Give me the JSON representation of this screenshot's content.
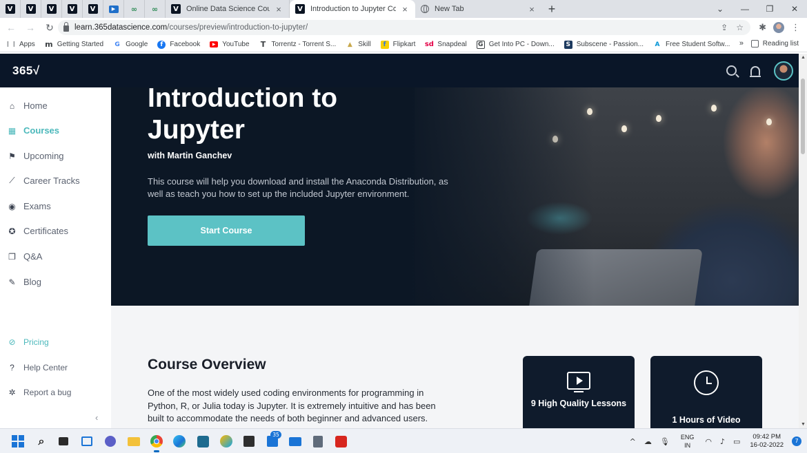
{
  "browser": {
    "tabs": [
      {
        "title": "Online Data Science Courses and",
        "active": false
      },
      {
        "title": "Introduction to Jupyter Course |",
        "active": true
      },
      {
        "title": "New Tab",
        "active": false
      }
    ],
    "close_glyph": "×",
    "new_tab_glyph": "+",
    "window_controls": [
      "⌄",
      "—",
      "❐",
      "✕"
    ],
    "url_host": "learn.365datascience.com",
    "url_path": "/courses/preview/introduction-to-jupyter/",
    "bookmarks": [
      {
        "label": "Apps",
        "icon": "apps-grid-icon",
        "color": "#5f6368"
      },
      {
        "label": "Getting Started",
        "icon": "m-icon",
        "color": "#3c4043"
      },
      {
        "label": "Google",
        "icon": "google-icon",
        "color": "#4285f4"
      },
      {
        "label": "Facebook",
        "icon": "facebook-icon",
        "color": "#1877f2"
      },
      {
        "label": "YouTube",
        "icon": "youtube-icon",
        "color": "#ff0000"
      },
      {
        "label": "Torrentz - Torrent S...",
        "icon": "t-icon",
        "color": "#3c4043"
      },
      {
        "label": "Skill",
        "icon": "skill-icon",
        "color": "#c8a84b"
      },
      {
        "label": "Flipkart",
        "icon": "flipkart-icon",
        "color": "#f8d000"
      },
      {
        "label": "Snapdeal",
        "icon": "snapdeal-icon",
        "color": "#e40046"
      },
      {
        "label": "Get Into PC - Down...",
        "icon": "g-icon",
        "color": "#3c4043"
      },
      {
        "label": "Subscene - Passion...",
        "icon": "s-icon",
        "color": "#3c4043"
      },
      {
        "label": "Free Student Softw...",
        "icon": "autodesk-icon",
        "color": "#0696d7"
      }
    ],
    "bookmarks_more": "»",
    "reading_list": "Reading list"
  },
  "site": {
    "logo": "365√",
    "nav": [
      {
        "label": "Home",
        "icon": "home-icon",
        "active": false
      },
      {
        "label": "Courses",
        "icon": "courses-icon",
        "active": true
      },
      {
        "label": "Upcoming",
        "icon": "upcoming-icon",
        "active": false
      },
      {
        "label": "Career Tracks",
        "icon": "career-tracks-icon",
        "active": false
      },
      {
        "label": "Exams",
        "icon": "exams-icon",
        "active": false
      },
      {
        "label": "Certificates",
        "icon": "certificates-icon",
        "active": false
      },
      {
        "label": "Q&A",
        "icon": "qa-icon",
        "active": false
      },
      {
        "label": "Blog",
        "icon": "blog-icon",
        "active": false
      }
    ],
    "nav_bottom": [
      {
        "label": "Pricing",
        "icon": "pricing-icon"
      },
      {
        "label": "Help Center",
        "icon": "help-icon"
      },
      {
        "label": "Report a bug",
        "icon": "bug-icon"
      }
    ],
    "collapse_glyph": "‹",
    "accent_color": "#5cc2c5"
  },
  "hero": {
    "title": "Introduction to Jupyter",
    "instructor": "with Martin Ganchev",
    "description": "This course will help you download and install the Anaconda Distribution, as well as teach you how to set up the included Jupyter environment.",
    "cta": "Start Course"
  },
  "overview": {
    "title": "Course Overview",
    "text": "One of the most widely used coding environments for programming in Python, R, or Julia today is Jupyter. It is extremely intuitive and has been built to accommodate the needs of both beginner and advanced users.",
    "cards": [
      {
        "label": "9 High Quality Lessons",
        "icon": "video-lesson-icon"
      },
      {
        "label": "1 Hours of Video",
        "icon": "clock-icon"
      }
    ]
  },
  "taskbar": {
    "mail_badge": "35",
    "lang_line1": "ENG",
    "lang_line2": "IN",
    "time": "09:42 PM",
    "date": "16-02-2022",
    "notifications": "7"
  }
}
